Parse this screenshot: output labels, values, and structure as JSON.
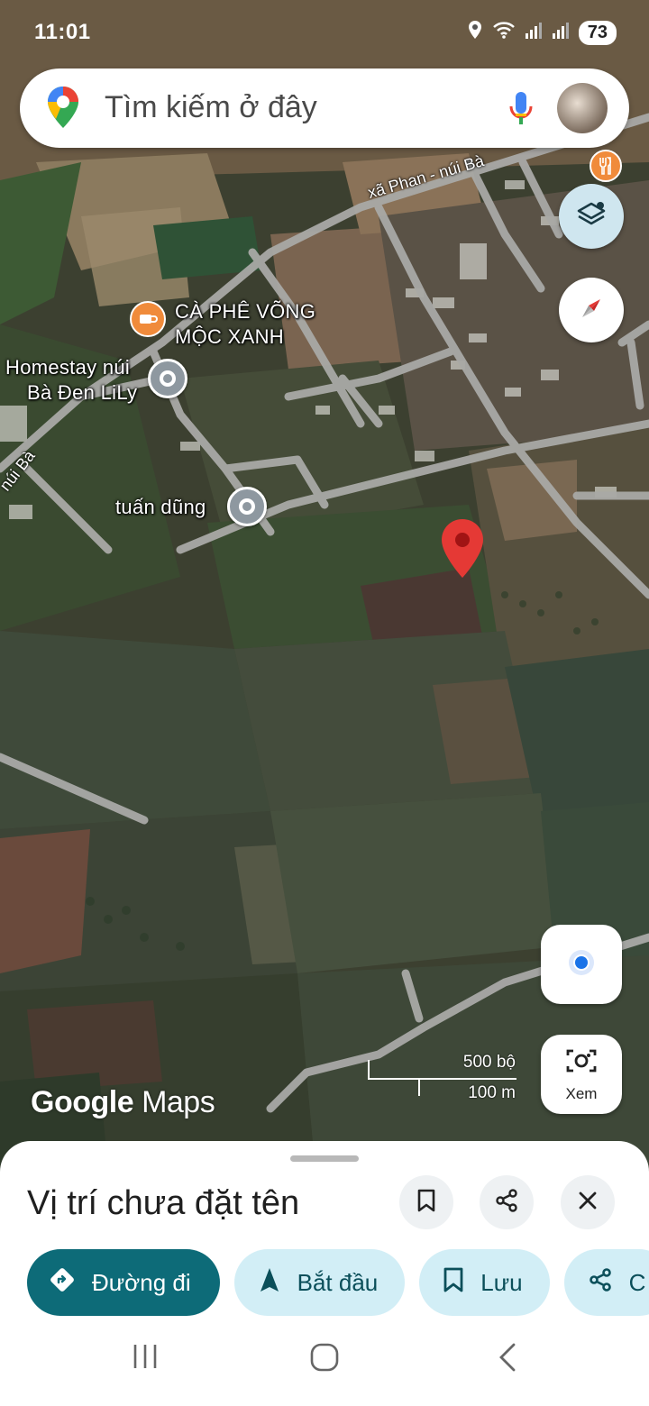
{
  "status_bar": {
    "time": "11:01",
    "battery": "73"
  },
  "search": {
    "placeholder": "Tìm kiếm ở đây"
  },
  "map": {
    "places": [
      {
        "line1": "CÀ PHÊ VÕNG",
        "line2": "MỘC XANH",
        "icon": "coffee-icon"
      },
      {
        "line1": "Homestay núi",
        "line2": "Bà Đen LiLy",
        "icon": "place-pin-icon"
      },
      {
        "line1": "tuấn dũng",
        "icon": "place-pin-icon"
      }
    ],
    "roads": [
      "xã Phan - núi Bà",
      "núi Bà"
    ],
    "scale": {
      "imperial": "500 bộ",
      "metric": "100 m"
    },
    "logo": {
      "word1": "Google",
      "word2": "Maps"
    },
    "view_button": "Xem"
  },
  "sheet": {
    "title": "Vị trí chưa đặt tên",
    "actions": [
      {
        "label": "Đường đi",
        "icon": "directions-icon"
      },
      {
        "label": "Bắt đầu",
        "icon": "navigation-arrow-icon"
      },
      {
        "label": "Lưu",
        "icon": "bookmark-icon"
      },
      {
        "label": "C",
        "icon": "share-icon"
      }
    ]
  },
  "colors": {
    "accent": "#0d6b78",
    "chip": "#d2eef6",
    "pin_red": "#e53935",
    "cafe_orange": "#f08b3b"
  }
}
